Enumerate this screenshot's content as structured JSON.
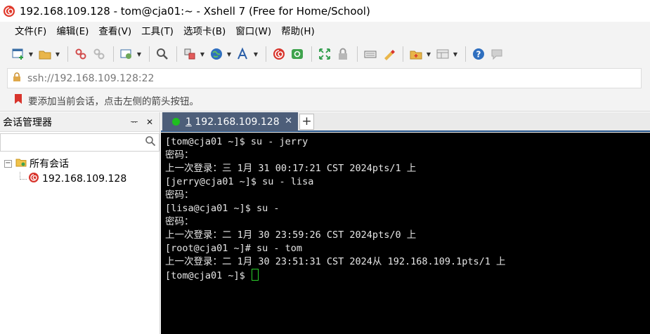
{
  "window": {
    "title": "192.168.109.128 - tom@cja01:~ - Xshell 7 (Free for Home/School)"
  },
  "menu": [
    "文件(F)",
    "编辑(E)",
    "查看(V)",
    "工具(T)",
    "选项卡(B)",
    "窗口(W)",
    "帮助(H)"
  ],
  "toolbar": {
    "icons": [
      "new-session-icon",
      "open-folder-icon",
      "disconnect-icon",
      "reconnect-icon",
      "properties-icon",
      "find-icon",
      "transfer-icon",
      "globe-icon",
      "font-icon",
      "xshell-icon",
      "xftp-icon",
      "fullscreen-icon",
      "lock-icon",
      "keyboard-icon",
      "highlight-icon",
      "new-folder-icon",
      "layout-icon",
      "help-icon",
      "chat-icon"
    ]
  },
  "address": {
    "value": "ssh://192.168.109.128:22"
  },
  "hint": {
    "text": "要添加当前会话，点击左侧的箭头按钮。"
  },
  "session_manager": {
    "title": "会话管理器",
    "pin": "ᅲ",
    "close": "✕",
    "tree": {
      "root_toggle": "−",
      "root_label": "所有会话",
      "child_label": "192.168.109.128"
    }
  },
  "tabs": {
    "active": {
      "index": "1",
      "label": "192.168.109.128",
      "close": "✕"
    },
    "add": "+"
  },
  "terminal": {
    "lines": [
      "[tom@cja01 ~]$ su - jerry",
      "密码：",
      "上一次登录：三 1月 31 00:17:21 CST 2024pts/1 上",
      "[jerry@cja01 ~]$ su - lisa",
      "密码：",
      "[lisa@cja01 ~]$ su -",
      "密码：",
      "上一次登录：二 1月 30 23:59:26 CST 2024pts/0 上",
      "[root@cja01 ~]# su - tom",
      "上一次登录：二 1月 30 23:51:31 CST 2024从 192.168.109.1pts/1 上"
    ],
    "prompt": "[tom@cja01 ~]$ "
  },
  "colors": {
    "tab_active": "#4d5e79",
    "status_green": "#1fbf1f",
    "cursor": "#2bd12b",
    "terminal_bg": "#000000"
  }
}
